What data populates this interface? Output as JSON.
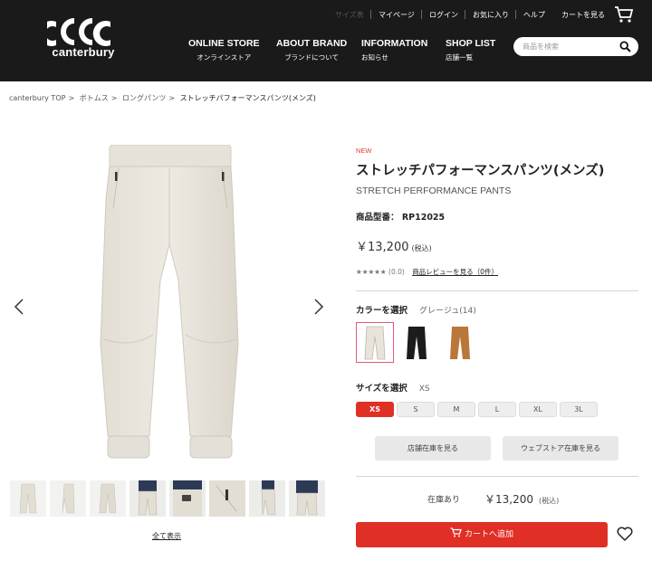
{
  "header": {
    "brand": "canterbury",
    "util_links": [
      "サイズ表",
      "マイページ",
      "ログイン",
      "お気に入り",
      "ヘルプ",
      "カートを見る"
    ],
    "nav": [
      {
        "en": "ONLINE STORE",
        "jp": "オンラインストア"
      },
      {
        "en": "ABOUT BRAND",
        "jp": "ブランドについて"
      },
      {
        "en": "INFORMATION",
        "jp": "お知らせ"
      },
      {
        "en": "SHOP LIST",
        "jp": "店舗一覧"
      }
    ],
    "search_placeholder": "商品を検索"
  },
  "breadcrumb": [
    "canterbury TOP",
    "ボトムス",
    "ロングパンツ",
    "ストレッチパフォーマンスパンツ(メンズ)"
  ],
  "product": {
    "badge": "NEW",
    "title": "ストレッチパフォーマンスパンツ(メンズ)",
    "subtitle": "STRETCH PERFORMANCE PANTS",
    "model_label": "商品型番：",
    "model_value": "RP12025",
    "price": "￥13,200",
    "tax_note": "(税込)",
    "rating_stars": "★★★★★",
    "rating_score": "(0.0)",
    "review_link": "商品レビューを見る（0件）",
    "color_label": "カラーを選択",
    "color_value": "グレージュ(14)",
    "colors": [
      {
        "name": "グレージュ",
        "hex": "#e9e4d9"
      },
      {
        "name": "ブラック",
        "hex": "#1c1c1c"
      },
      {
        "name": "ブラウン",
        "hex": "#b9773a"
      }
    ],
    "size_label": "サイズを選択",
    "size_value": "XS",
    "sizes": [
      "XS",
      "S",
      "M",
      "L",
      "XL",
      "3L"
    ],
    "selected_size": "XS",
    "store_stock_btn": "店舗在庫を見る",
    "web_stock_btn": "ウェブストア在庫を見る",
    "stock_status": "在庫あり",
    "bottom_price": "￥13,200",
    "bottom_tax": "(税込)",
    "add_to_cart": "カートへ追加"
  },
  "gallery": {
    "show_all": "全て表示",
    "thumbs": [
      "front",
      "side",
      "back",
      "model-front",
      "model-pocket",
      "detail-pocket",
      "model-side",
      "model-back"
    ]
  },
  "colors": {
    "accent": "#e02f25",
    "header_bg": "#1a1a1a",
    "swatch_selected_border": "#e8577c"
  }
}
